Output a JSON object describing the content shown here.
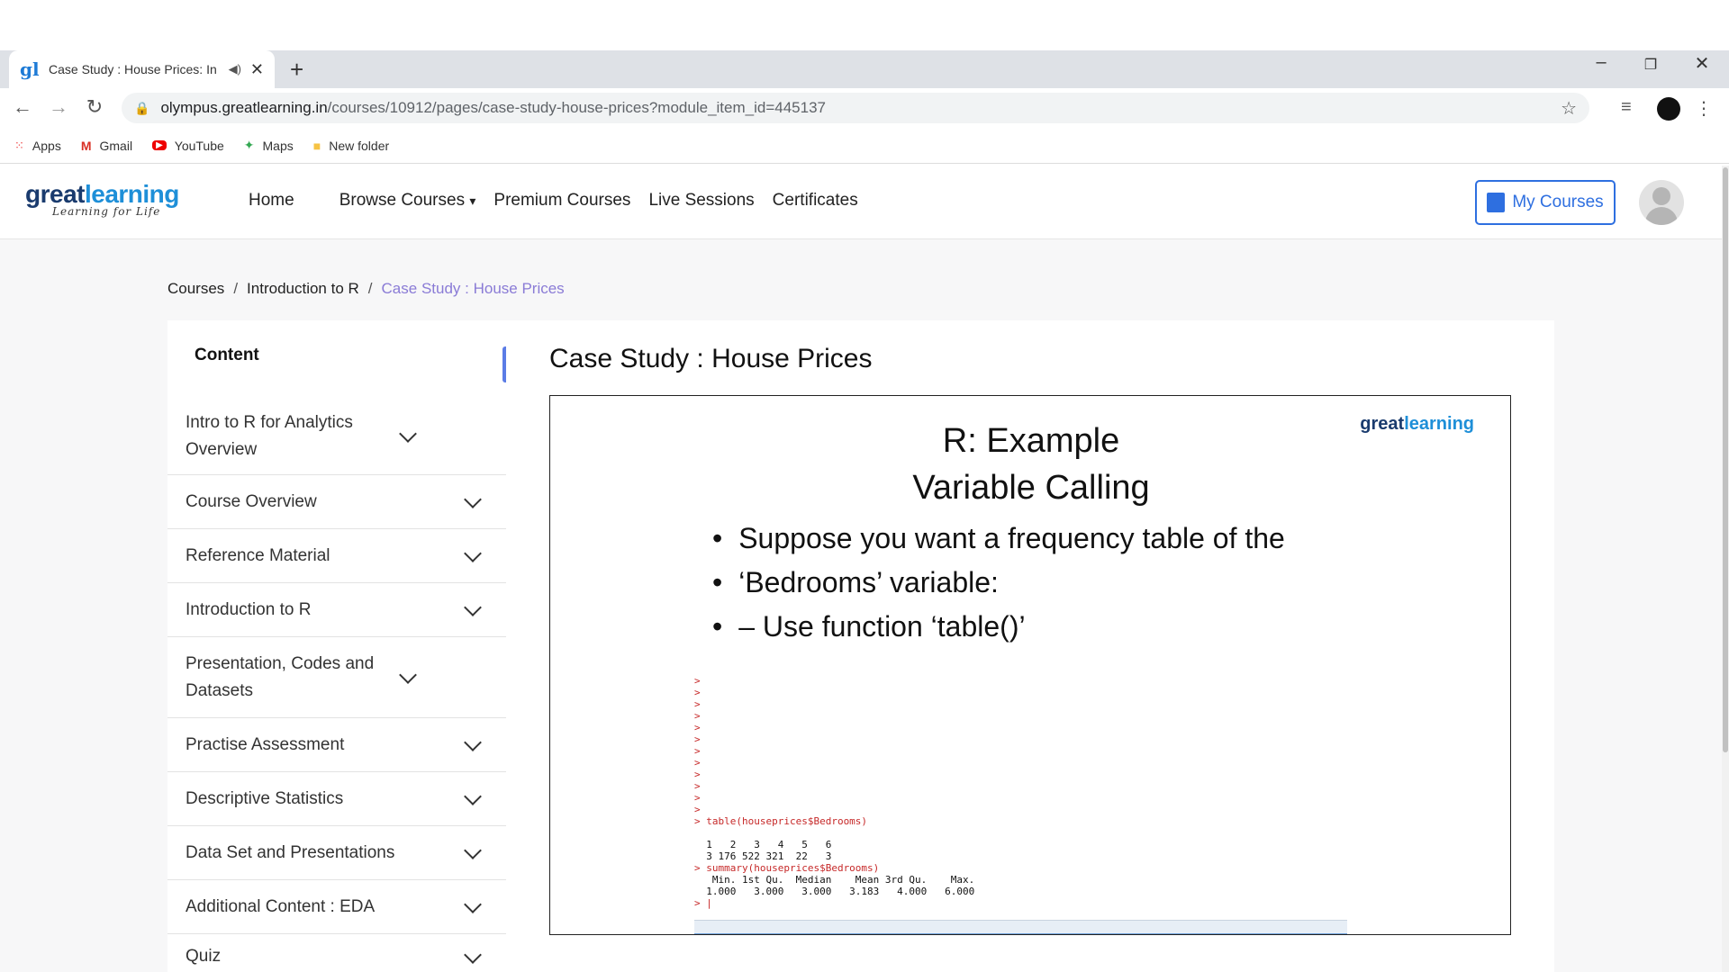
{
  "browser": {
    "tab_title": "Case Study : House Prices: In",
    "url_host": "olympus.greatlearning.in",
    "url_path": "/courses/10912/pages/case-study-house-prices?module_item_id=445137",
    "bookmarks": [
      {
        "label": "Apps",
        "icon": "apps-grid-icon"
      },
      {
        "label": "Gmail",
        "icon": "gmail-icon"
      },
      {
        "label": "YouTube",
        "icon": "youtube-icon"
      },
      {
        "label": "Maps",
        "icon": "maps-icon"
      },
      {
        "label": "New folder",
        "icon": "folder-icon"
      }
    ]
  },
  "site": {
    "logo_main_a": "great",
    "logo_main_b": "learning",
    "logo_tagline": "Learning for Life",
    "nav": [
      "Home",
      "Browse Courses",
      "Premium Courses",
      "Live Sessions",
      "Certificates"
    ],
    "my_courses": "My Courses"
  },
  "breadcrumb": {
    "items": [
      "Courses",
      "Introduction to R"
    ],
    "current": "Case Study : House Prices"
  },
  "sidebar": {
    "heading": "Content",
    "sections": [
      "Intro to R for Analytics Overview",
      "Course Overview",
      "Reference Material",
      "Introduction to R",
      "Presentation, Codes and Datasets",
      "Practise Assessment",
      "Descriptive Statistics",
      "Data Set and Presentations",
      "Additional Content : EDA",
      "Quiz"
    ]
  },
  "main": {
    "title": "Case Study : House Prices",
    "slide": {
      "brand_a": "great",
      "brand_b": "learning",
      "title_line1": "R: Example",
      "title_line2": "Variable Calling",
      "bullets": [
        "Suppose you want a frequency table of the",
        "‘Bedrooms’ variable:",
        "– Use function ‘table()’"
      ],
      "console": {
        "cmd1": "> table(houseprices$Bedrooms)",
        "tbl_head": "  1   2   3   4   5   6",
        "tbl_vals": "  3 176 522 321  22   3",
        "cmd2": "> summary(houseprices$Bedrooms)",
        "sum_head": "   Min. 1st Qu.  Median    Mean 3rd Qu.    Max.",
        "sum_vals": "  1.000   3.000   3.000   3.183   4.000   6.000"
      }
    }
  }
}
